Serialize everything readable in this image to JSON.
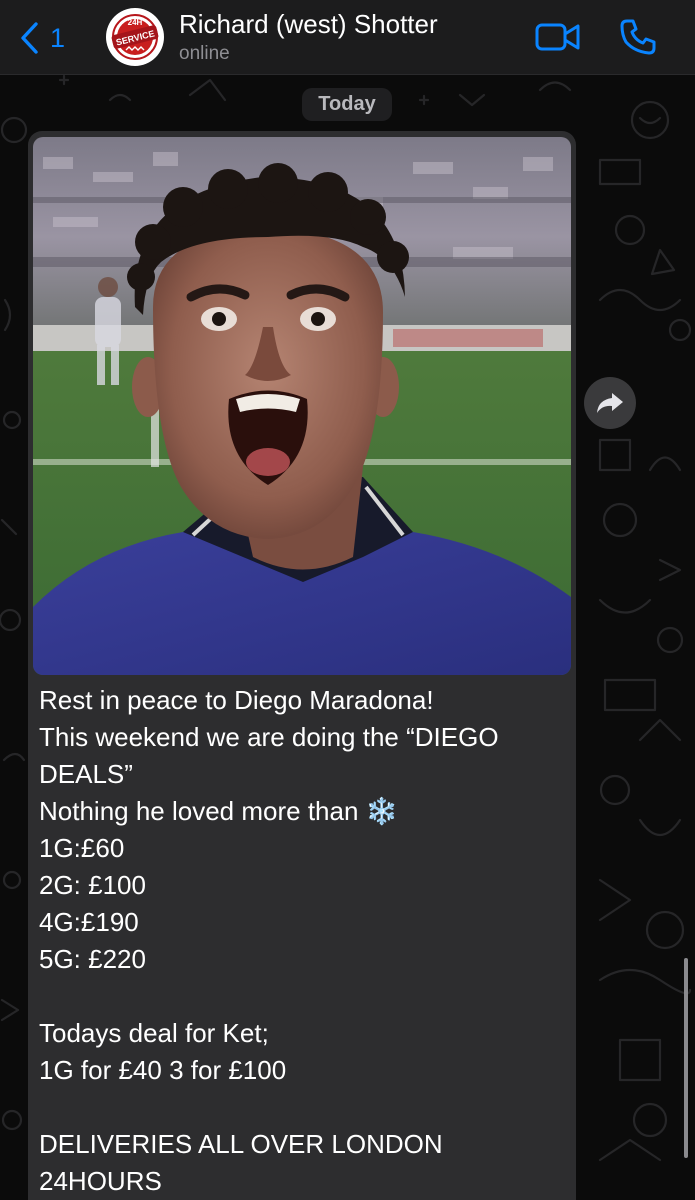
{
  "header": {
    "back_count": "1",
    "avatar_badge_line1": "24H",
    "avatar_badge_line2": "SERVICE",
    "contact_name": "Richard (west) Shotter",
    "status": "online"
  },
  "chat": {
    "date_label": "Today"
  },
  "message": {
    "image_alt": "Photo of Diego Maradona shouting in a blue shirt on a football pitch",
    "text": "Rest in peace to Diego Maradona!\nThis weekend we are doing the “DIEGO DEALS”\nNothing he loved more than ❄️\n1G:£60\n2G: £100\n4G:£190\n5G: £220\n\nTodays deal for Ket;\n1G for £40 3 for £100\n\nDELIVERIES ALL OVER LONDON\n24HOURS"
  },
  "colors": {
    "accent": "#0a84ff",
    "bubble": "#2d2d2f",
    "header": "#1c1c1d",
    "background": "#0b0b0b"
  },
  "icons": {
    "back": "chevron-left-icon",
    "video": "video-camera-icon",
    "phone": "phone-icon",
    "forward": "forward-arrow-icon"
  }
}
